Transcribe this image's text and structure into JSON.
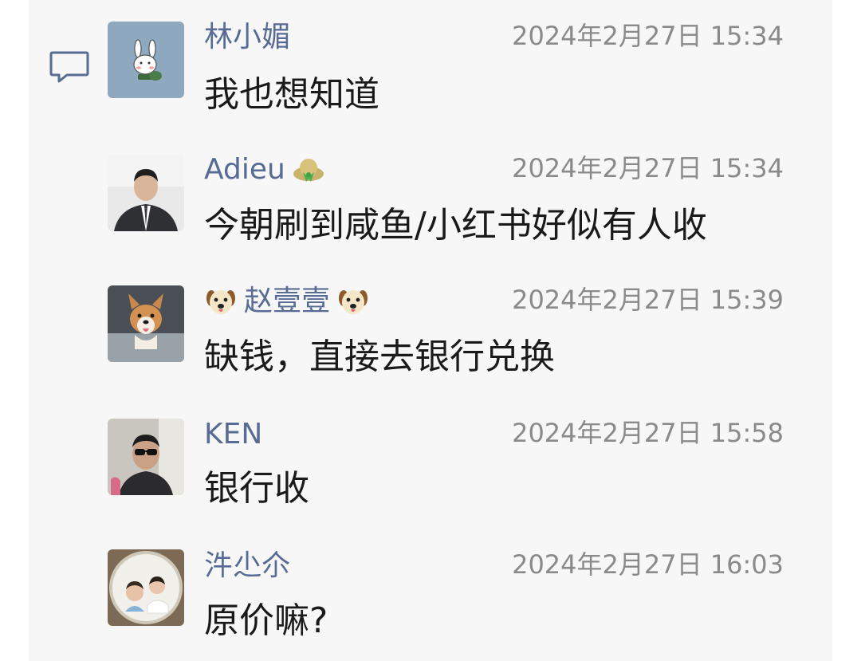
{
  "theme": {
    "name_color": "#576b95",
    "time_color": "#8a8a8a",
    "text_color": "#1a1a1a",
    "panel_bg": "#f7f7f7"
  },
  "comments": [
    {
      "name": "林小媚",
      "time": "2024年2月27日 15:34",
      "text": "我也想知道",
      "avatar": "rabbit-cartoon-avatar"
    },
    {
      "name": "Adieu",
      "time": "2024年2月27日 15:34",
      "text": "今朝刷到咸鱼/小红书好似有人收",
      "avatar": "man-in-suit-avatar",
      "name_suffix_icon": "hat-emoji-icon"
    },
    {
      "name": "赵壹壹",
      "time": "2024年2月27日 15:39",
      "text": "缺钱，直接去银行兑换",
      "avatar": "dog-avatar",
      "name_prefix_icon": "dog-face-emoji-icon",
      "name_suffix_icon": "dog-face-emoji-icon"
    },
    {
      "name": "KEN",
      "time": "2024年2月27日 15:58",
      "text": "银行收",
      "avatar": "man-sunglasses-avatar"
    },
    {
      "name": "汼尐尒",
      "time": "2024年2月27日 16:03",
      "text": "原价嘛?",
      "avatar": "children-avatar"
    }
  ]
}
